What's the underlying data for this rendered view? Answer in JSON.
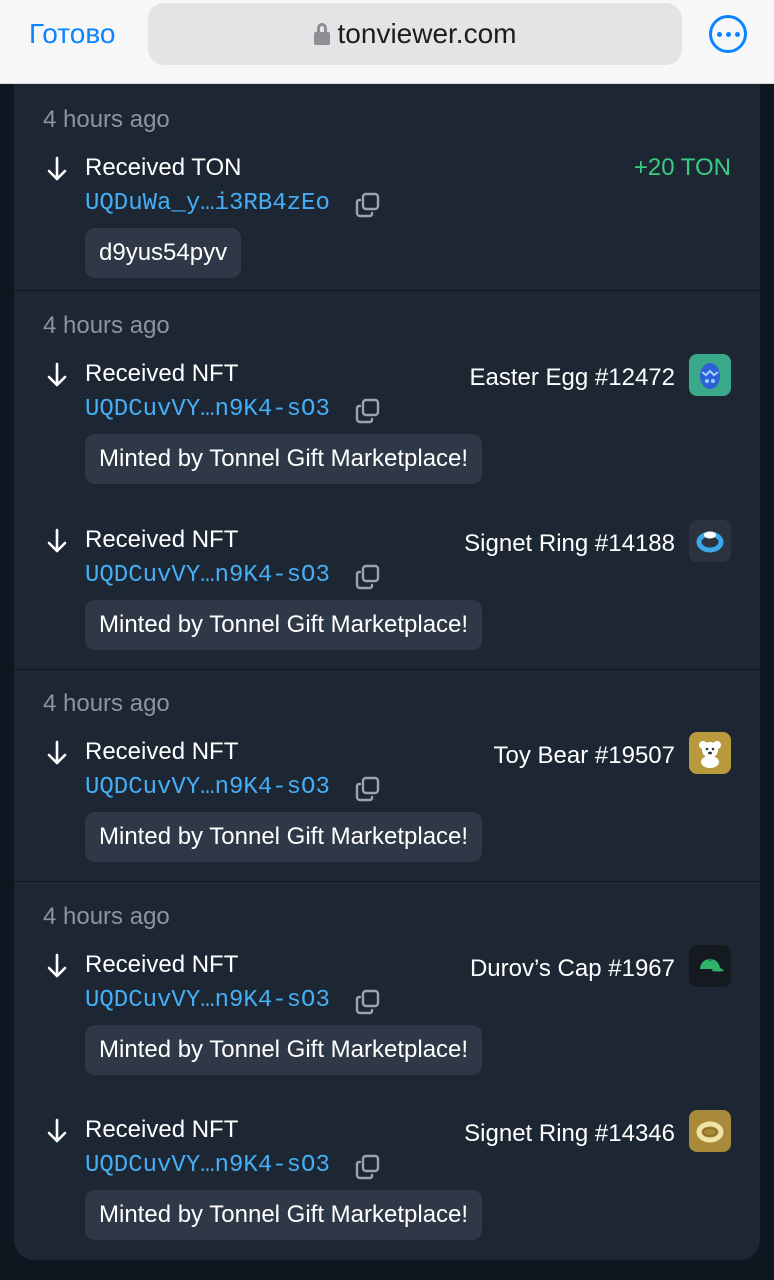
{
  "browser": {
    "done_label": "Готово",
    "url": "tonviewer.com"
  },
  "events": [
    {
      "time": "4 hours ago",
      "actions": [
        {
          "action": "Received TON",
          "address": "UQDuWa_y…i3RB4zEo",
          "amount": "+20 TON",
          "comment": "d9yus54pyv"
        }
      ]
    },
    {
      "time": "4 hours ago",
      "actions": [
        {
          "action": "Received NFT",
          "address": "UQDCuvVY…n9K4-sO3",
          "nft": "Easter Egg #12472",
          "thumb_icon": "easter-egg-icon",
          "thumb_color": "#3aa98a",
          "comment": "Minted by Tonnel Gift Marketplace!"
        },
        {
          "action": "Received NFT",
          "address": "UQDCuvVY…n9K4-sO3",
          "nft": "Signet Ring #14188",
          "thumb_icon": "ring-icon",
          "thumb_color": "#2b333f",
          "comment": "Minted by Tonnel Gift Marketplace!"
        }
      ]
    },
    {
      "time": "4 hours ago",
      "actions": [
        {
          "action": "Received NFT",
          "address": "UQDCuvVY…n9K4-sO3",
          "nft": "Toy Bear #19507",
          "thumb_icon": "bear-icon",
          "thumb_color": "#b89a3c",
          "comment": "Minted by Tonnel Gift Marketplace!"
        }
      ]
    },
    {
      "time": "4 hours ago",
      "actions": [
        {
          "action": "Received NFT",
          "address": "UQDCuvVY…n9K4-sO3",
          "nft": "Durov’s Cap #1967",
          "thumb_icon": "cap-icon",
          "thumb_color": "#141a20",
          "comment": "Minted by Tonnel Gift Marketplace!"
        },
        {
          "action": "Received NFT",
          "address": "UQDCuvVY…n9K4-sO3",
          "nft": "Signet Ring #14346",
          "thumb_icon": "ring-icon",
          "thumb_color": "#a98a3a",
          "comment": "Minted by Tonnel Gift Marketplace!"
        }
      ]
    }
  ]
}
